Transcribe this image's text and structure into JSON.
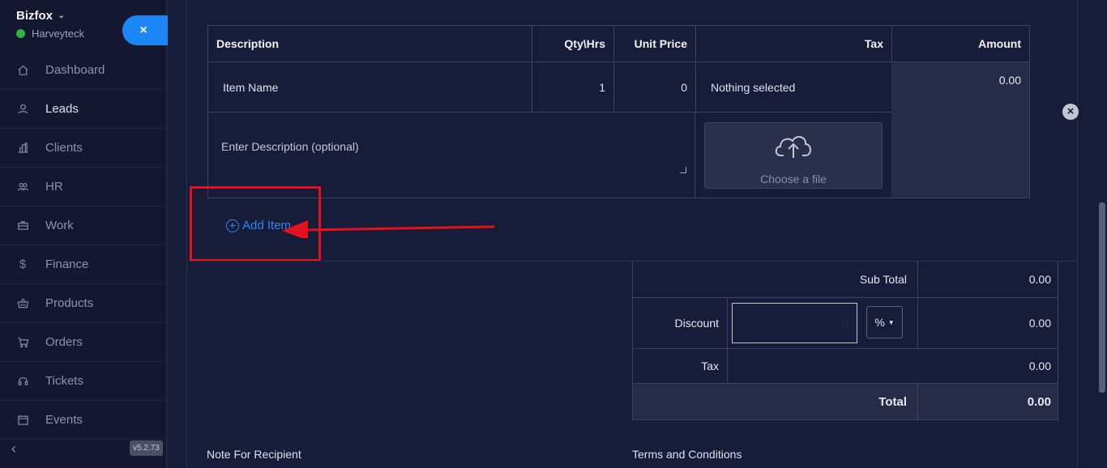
{
  "sidebar": {
    "brand": "Bizfox",
    "workspace": "Harveyteck",
    "collapse_icon": "×",
    "version": "v5.2.73",
    "items": [
      {
        "label": "Dashboard",
        "icon": "home-icon"
      },
      {
        "label": "Leads",
        "icon": "user-icon"
      },
      {
        "label": "Clients",
        "icon": "building-icon"
      },
      {
        "label": "HR",
        "icon": "users-icon"
      },
      {
        "label": "Work",
        "icon": "briefcase-icon"
      },
      {
        "label": "Finance",
        "icon": "dollar-icon"
      },
      {
        "label": "Products",
        "icon": "basket-icon"
      },
      {
        "label": "Orders",
        "icon": "cart-icon"
      },
      {
        "label": "Tickets",
        "icon": "headset-icon"
      },
      {
        "label": "Events",
        "icon": "calendar-icon"
      }
    ]
  },
  "items_table": {
    "headers": {
      "description": "Description",
      "qty": "Qty\\Hrs",
      "unit_price": "Unit Price",
      "tax": "Tax",
      "amount": "Amount"
    },
    "row": {
      "item_name_placeholder": "Item Name",
      "qty": "1",
      "unit_price": "0",
      "tax": "Nothing selected",
      "amount": "0.00",
      "description_placeholder": "Enter Description (optional)",
      "upload_label": "Choose a file"
    }
  },
  "add_item": "Add Item",
  "totals": {
    "sub_total_label": "Sub Total",
    "sub_total": "0.00",
    "discount_label": "Discount",
    "discount_value": "0",
    "discount_type": "%",
    "discount_amount": "0.00",
    "tax_label": "Tax",
    "tax": "0.00",
    "total_label": "Total",
    "total": "0.00"
  },
  "footer": {
    "note_label": "Note For Recipient",
    "terms_label": "Terms and Conditions"
  },
  "colors": {
    "accent": "#1d86f7",
    "highlight": "#e3101d",
    "status_online": "#2fb344"
  }
}
